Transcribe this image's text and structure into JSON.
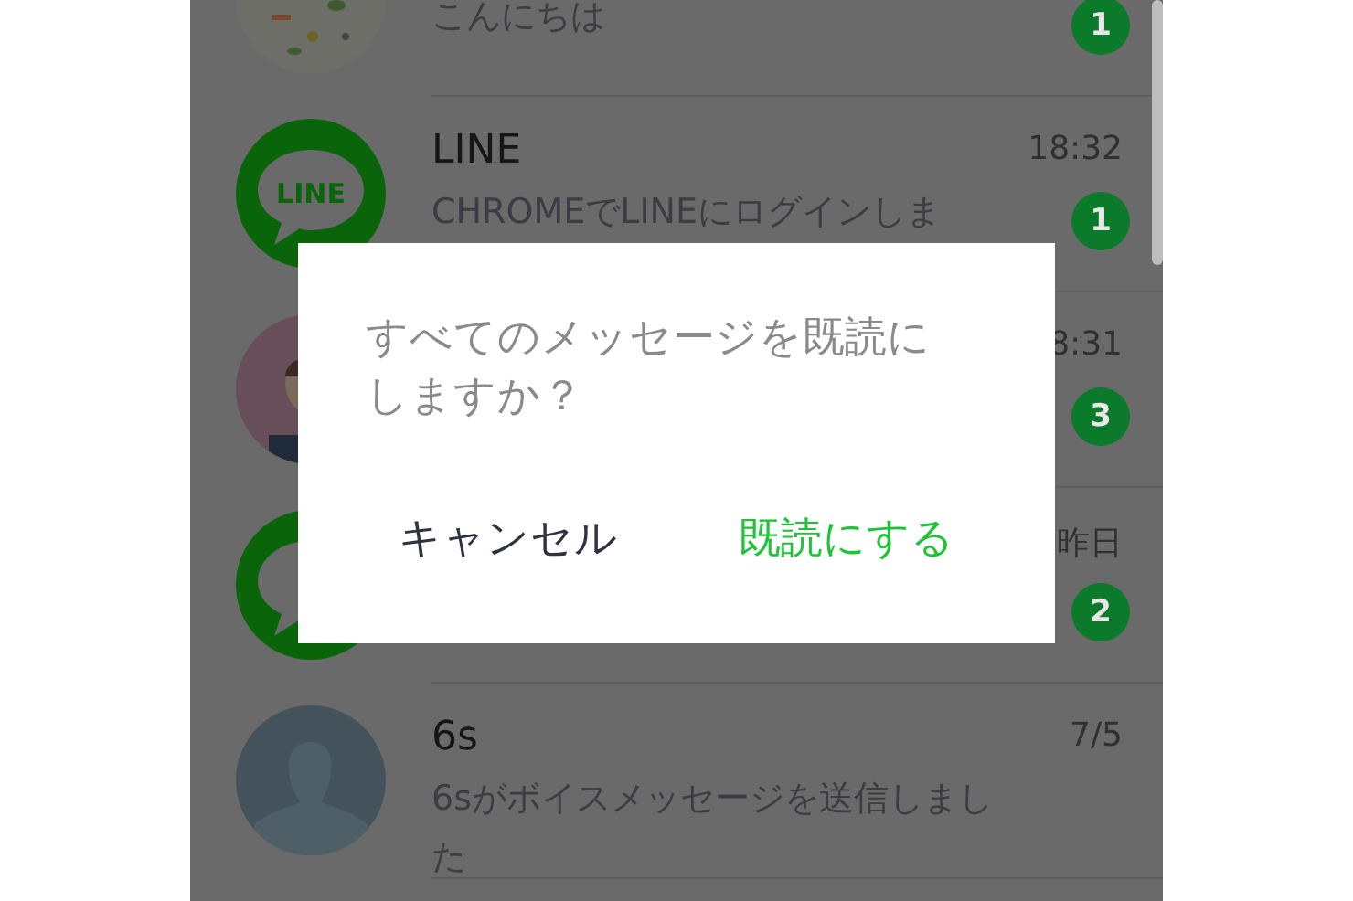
{
  "chat_list": [
    {
      "preview": "こんにちは",
      "badge": "1"
    },
    {
      "avatar": {
        "kind": "logo",
        "text": "LINE"
      },
      "name": "LINE",
      "time": "18:32",
      "preview": "CHROMEでLINEにログインしま",
      "badge": "1"
    },
    {
      "avatar": {
        "kind": "person"
      },
      "time": "8:31",
      "badge": "3"
    },
    {
      "avatar": {
        "kind": "logo"
      },
      "time": "昨日",
      "badge": "2"
    },
    {
      "avatar": {
        "kind": "silhouette"
      },
      "name": "6s",
      "time": "7/5",
      "preview": "6sがボイスメッセージを送信しました"
    }
  ],
  "dialog": {
    "message": "すべてのメッセージを既読にしますか？",
    "buttons": [
      {
        "label": "キャンセル",
        "kind": "cancel"
      },
      {
        "label": "既読にする",
        "kind": "confirm"
      }
    ]
  }
}
